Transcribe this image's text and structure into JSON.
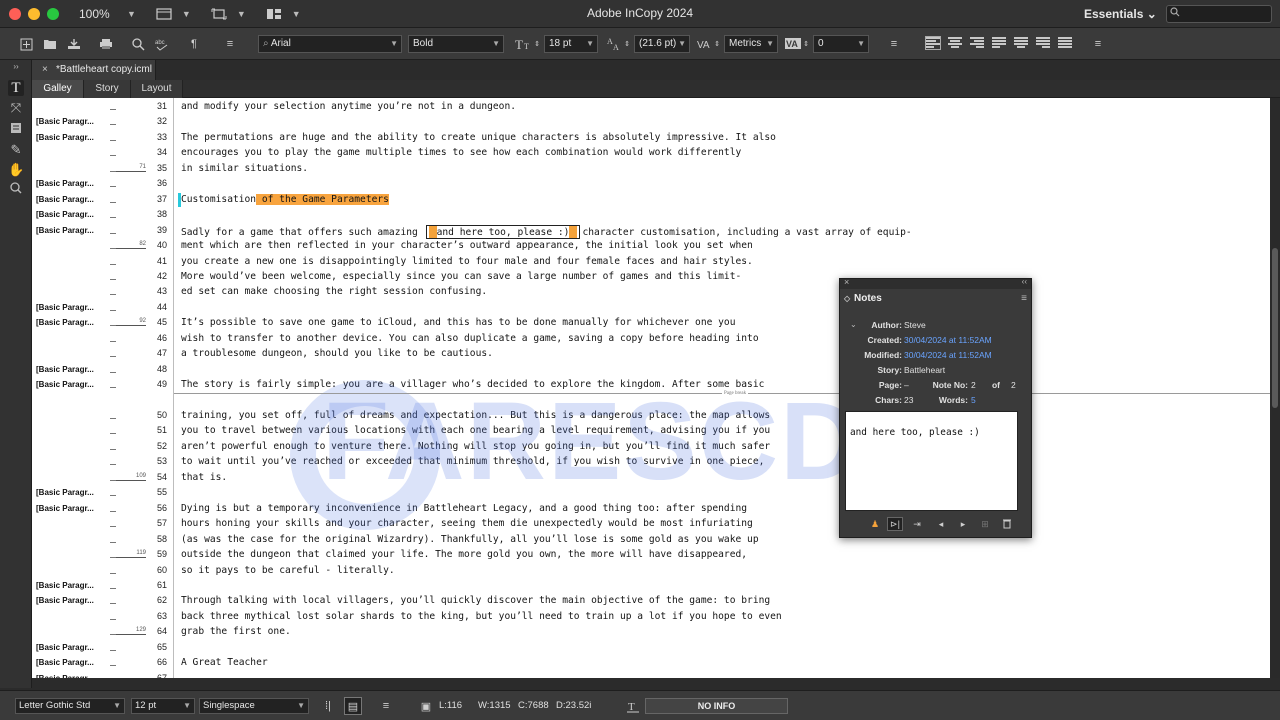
{
  "window": {
    "title": "Adobe InCopy 2024",
    "zoom": "100%",
    "workspace": "Essentials",
    "search_placeholder": ""
  },
  "control_bar": {
    "font_family": "Arial",
    "font_style": "Bold",
    "font_size": "18 pt",
    "leading": "(21.6 pt)",
    "kerning": "Metrics",
    "tracking": "0"
  },
  "document": {
    "tab_label": "*Battleheart copy.icml",
    "view_tabs": [
      "Galley",
      "Story",
      "Layout"
    ]
  },
  "galley": {
    "page_break_label": "Page break",
    "lines": [
      {
        "n": "31",
        "style": "",
        "depth": "",
        "text": "and modify your selection anytime you’re not in a dungeon."
      },
      {
        "n": "32",
        "style": "[Basic Paragr...",
        "depth": "",
        "text": ""
      },
      {
        "n": "33",
        "style": "[Basic Paragr...",
        "depth": "",
        "text": "The permutations are huge and the ability to create unique characters is absolutely impressive. It also"
      },
      {
        "n": "34",
        "style": "",
        "depth": "",
        "text": "encourages you to play the game multiple times to see how each combination would work differently"
      },
      {
        "n": "35",
        "style": "",
        "depth": "71",
        "text": "in similar situations."
      },
      {
        "n": "36",
        "style": "[Basic Paragr...",
        "depth": "",
        "text": ""
      },
      {
        "n": "37",
        "style": "[Basic Paragr...",
        "depth": "",
        "text": ""
      },
      {
        "n": "38",
        "style": "[Basic Paragr...",
        "depth": "",
        "text": ""
      },
      {
        "n": "39",
        "style": "[Basic Paragr...",
        "depth": "",
        "text": ""
      },
      {
        "n": "40",
        "style": "",
        "depth": "82",
        "text": "ment which are then reflected in your character’s outward appearance, the initial look you set when"
      },
      {
        "n": "41",
        "style": "",
        "depth": "",
        "text": "you create a new one is disappointingly limited to four male and four female faces and hair styles."
      },
      {
        "n": "42",
        "style": "",
        "depth": "",
        "text": "More would’ve been welcome, especially since you can save a large number of games and this limit-"
      },
      {
        "n": "43",
        "style": "",
        "depth": "",
        "text": "ed set can make choosing the right session confusing."
      },
      {
        "n": "44",
        "style": "[Basic Paragr...",
        "depth": "",
        "text": ""
      },
      {
        "n": "45",
        "style": "[Basic Paragr...",
        "depth": "92",
        "text": "It’s possible to save one game to iCloud, and this has to be done manually for whichever one you"
      },
      {
        "n": "46",
        "style": "",
        "depth": "",
        "text": "wish to transfer to another device. You can also duplicate a game, saving a copy before heading into"
      },
      {
        "n": "47",
        "style": "",
        "depth": "",
        "text": "a troublesome dungeon, should you like to be cautious."
      },
      {
        "n": "48",
        "style": "[Basic Paragr...",
        "depth": "",
        "text": ""
      },
      {
        "n": "49",
        "style": "[Basic Paragr...",
        "depth": "",
        "text": "The story is fairly simple: you are a villager who’s decided to explore the kingdom. After some basic"
      },
      {
        "n": "50",
        "style": "",
        "depth": "",
        "text": "training, you set off, full of dreams and expectation... But this is a dangerous place: the map allows"
      },
      {
        "n": "51",
        "style": "",
        "depth": "",
        "text": "you to travel between various locations with each one bearing a level requirement, advising you if you"
      },
      {
        "n": "52",
        "style": "",
        "depth": "",
        "text": "aren’t powerful enough to venture there. Nothing will stop you going in, but you’ll find it much safer"
      },
      {
        "n": "53",
        "style": "",
        "depth": "",
        "text": "to wait until you’ve reached or exceeded that minimum threshold, if you wish to survive in one piece,"
      },
      {
        "n": "54",
        "style": "",
        "depth": "109",
        "text": "that is."
      },
      {
        "n": "55",
        "style": "[Basic Paragr...",
        "depth": "",
        "text": ""
      },
      {
        "n": "56",
        "style": "[Basic Paragr...",
        "depth": "",
        "text": "Dying is but a temporary inconvenience in Battleheart Legacy, and a good thing too: after spending"
      },
      {
        "n": "57",
        "style": "",
        "depth": "",
        "text": "hours honing your skills and your character, seeing them die unexpectedly would be most infuriating"
      },
      {
        "n": "58",
        "style": "",
        "depth": "",
        "text": "(as was the case for the original Wizardry). Thankfully, all you’ll lose is some gold as you wake up"
      },
      {
        "n": "59",
        "style": "",
        "depth": "119",
        "text": "outside the dungeon that claimed your life. The more gold you own, the more will have disappeared,"
      },
      {
        "n": "60",
        "style": "",
        "depth": "",
        "text": "so it pays to be careful - literally."
      },
      {
        "n": "61",
        "style": "[Basic Paragr...",
        "depth": "",
        "text": ""
      },
      {
        "n": "62",
        "style": "[Basic Paragr...",
        "depth": "",
        "text": "Through talking with local villagers, you’ll quickly discover the main objective of the game: to bring"
      },
      {
        "n": "63",
        "style": "",
        "depth": "",
        "text": "back three mythical lost solar shards to the king, but you’ll need to train up a lot if you hope to even"
      },
      {
        "n": "64",
        "style": "",
        "depth": "129",
        "text": "grab the first one."
      },
      {
        "n": "65",
        "style": "[Basic Paragr...",
        "depth": "",
        "text": ""
      },
      {
        "n": "66",
        "style": "[Basic Paragr...",
        "depth": "",
        "text": "A Great Teacher"
      },
      {
        "n": "67",
        "style": "[Basic Paragr...",
        "depth": "",
        "text": ""
      }
    ],
    "heading_37_a": "Customisation",
    "heading_37_b": " of the Game Parameters",
    "line_39_a": "Sadly for a game that offers such amazing ",
    "line_39_note": "and here too, please :)",
    "line_39_b": "character customisation, including a vast array of equip-"
  },
  "notes_panel": {
    "title": "Notes",
    "author_label": "Author:",
    "author": "Steve",
    "created_label": "Created:",
    "created": "30/04/2024 at 11:52AM",
    "modified_label": "Modified:",
    "modified": "30/04/2024 at 11:52AM",
    "story_label": "Story:",
    "story": "Battleheart",
    "page_label": "Page:",
    "page": "–",
    "note_no_label": "Note No:",
    "note_no": "2",
    "of_label": "of",
    "of_value": "2",
    "chars_label": "Chars:",
    "chars": "23",
    "words_label": "Words:",
    "words": "5",
    "note_text": "and here too, please :)"
  },
  "status_bar": {
    "font": "Letter Gothic Std",
    "size": "12 pt",
    "spacing": "Singlespace",
    "lines": "L:116",
    "words": "W:1315",
    "chars": "C:7688",
    "depth": "D:23.52i",
    "info": "NO INFO"
  },
  "watermark": {
    "text": "FARESCD"
  },
  "colors": {
    "highlight": "#f8a43e",
    "cyan_marker": "#27c9dc",
    "accent_blue": "#6aa4ff"
  }
}
